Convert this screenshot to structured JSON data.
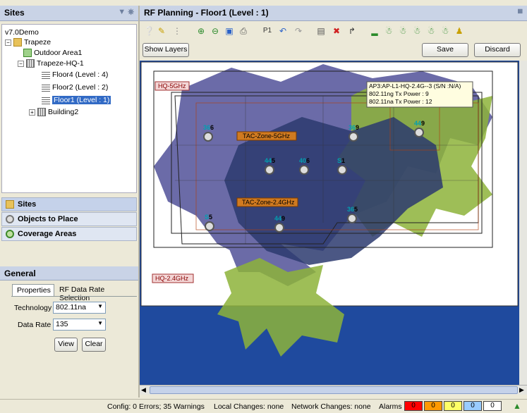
{
  "sites_panel": {
    "title": "Sites",
    "tree": [
      {
        "label": "v7.0Demo"
      },
      {
        "label": "Trapeze"
      },
      {
        "label": "Outdoor Area1"
      },
      {
        "label": "Trapeze-HQ-1"
      },
      {
        "label": "Floor4 (Level : 4)"
      },
      {
        "label": "Floor2 (Level : 2)"
      },
      {
        "label": "Floor1 (Level : 1)"
      },
      {
        "label": "Building2"
      }
    ],
    "nav": {
      "sites": "Sites",
      "objects": "Objects to Place",
      "coverage": "Coverage Areas"
    }
  },
  "general_panel": {
    "title": "General",
    "tabs": [
      "Properties",
      "RF Data Rate Selection"
    ],
    "technology_label": "Technology",
    "technology_value": "802.11na",
    "data_rate_label": "Data Rate",
    "data_rate_value": "135",
    "view_button": "View",
    "clear_button": "Clear"
  },
  "rf_panel": {
    "title": "RF Planning - Floor1 (Level : 1)",
    "show_layers": "Show Layers",
    "save": "Save",
    "discard": "Discard",
    "toolbar_icons": [
      "help-icon",
      "measure-icon",
      "grid-icon",
      "zoom-in-icon",
      "zoom-out-icon",
      "zoom-fit-icon",
      "print-icon",
      "label-icon",
      "undo-icon",
      "redo-icon",
      "preview-icon",
      "delete-icon",
      "dimension-icon",
      "signal-bars-icon",
      "ap-a-icon",
      "ap-b-icon",
      "ap-g-icon",
      "ap-na-icon",
      "ap-ng-icon",
      "person-icon"
    ],
    "zone_labels": {
      "hq5": "HQ-5GHz",
      "hq24": "HQ-2.4GHz",
      "tac5": "TAC-Zone-5GHz",
      "tac24": "TAC-Zone-2.4GHz"
    },
    "tooltip": {
      "line1": "AP3:AP-L1-HQ-2.4G--3 (S/N :N/A)",
      "line2": "802.11ng Tx Power : 9",
      "line3": "802.11na Tx Power : 12"
    },
    "aps": [
      {
        "ch_a": "36",
        "ch_b": "6"
      },
      {
        "ch_a": "36",
        "ch_b": "9"
      },
      {
        "ch_a": "44",
        "ch_b": "9"
      },
      {
        "ch_a": "44",
        "ch_b": "5"
      },
      {
        "ch_a": "40",
        "ch_b": "6"
      },
      {
        "ch_a": "S",
        "ch_b": "1"
      },
      {
        "ch_a": "S",
        "ch_b": "5"
      },
      {
        "ch_a": "44",
        "ch_b": "9"
      },
      {
        "ch_a": "36",
        "ch_b": "5"
      }
    ]
  },
  "status": {
    "config": "Config: 0 Errors; 35 Warnings",
    "local": "Local Changes: none",
    "network": "Network Changes: none",
    "alarms_label": "Alarms",
    "alarms": [
      {
        "value": "0",
        "color": "#ff0000"
      },
      {
        "value": "0",
        "color": "#ff9900"
      },
      {
        "value": "0",
        "color": "#ffff66"
      },
      {
        "value": "0",
        "color": "#99ccff"
      },
      {
        "value": "0",
        "color": "#ffffff"
      }
    ]
  },
  "colors": {
    "selection": "#316ac5",
    "canvas_bg": "#1f4a9e",
    "header_bg": "#c9d3e6",
    "coverage_green": "#8db33a",
    "coverage_purple": "#5b5b9e"
  }
}
